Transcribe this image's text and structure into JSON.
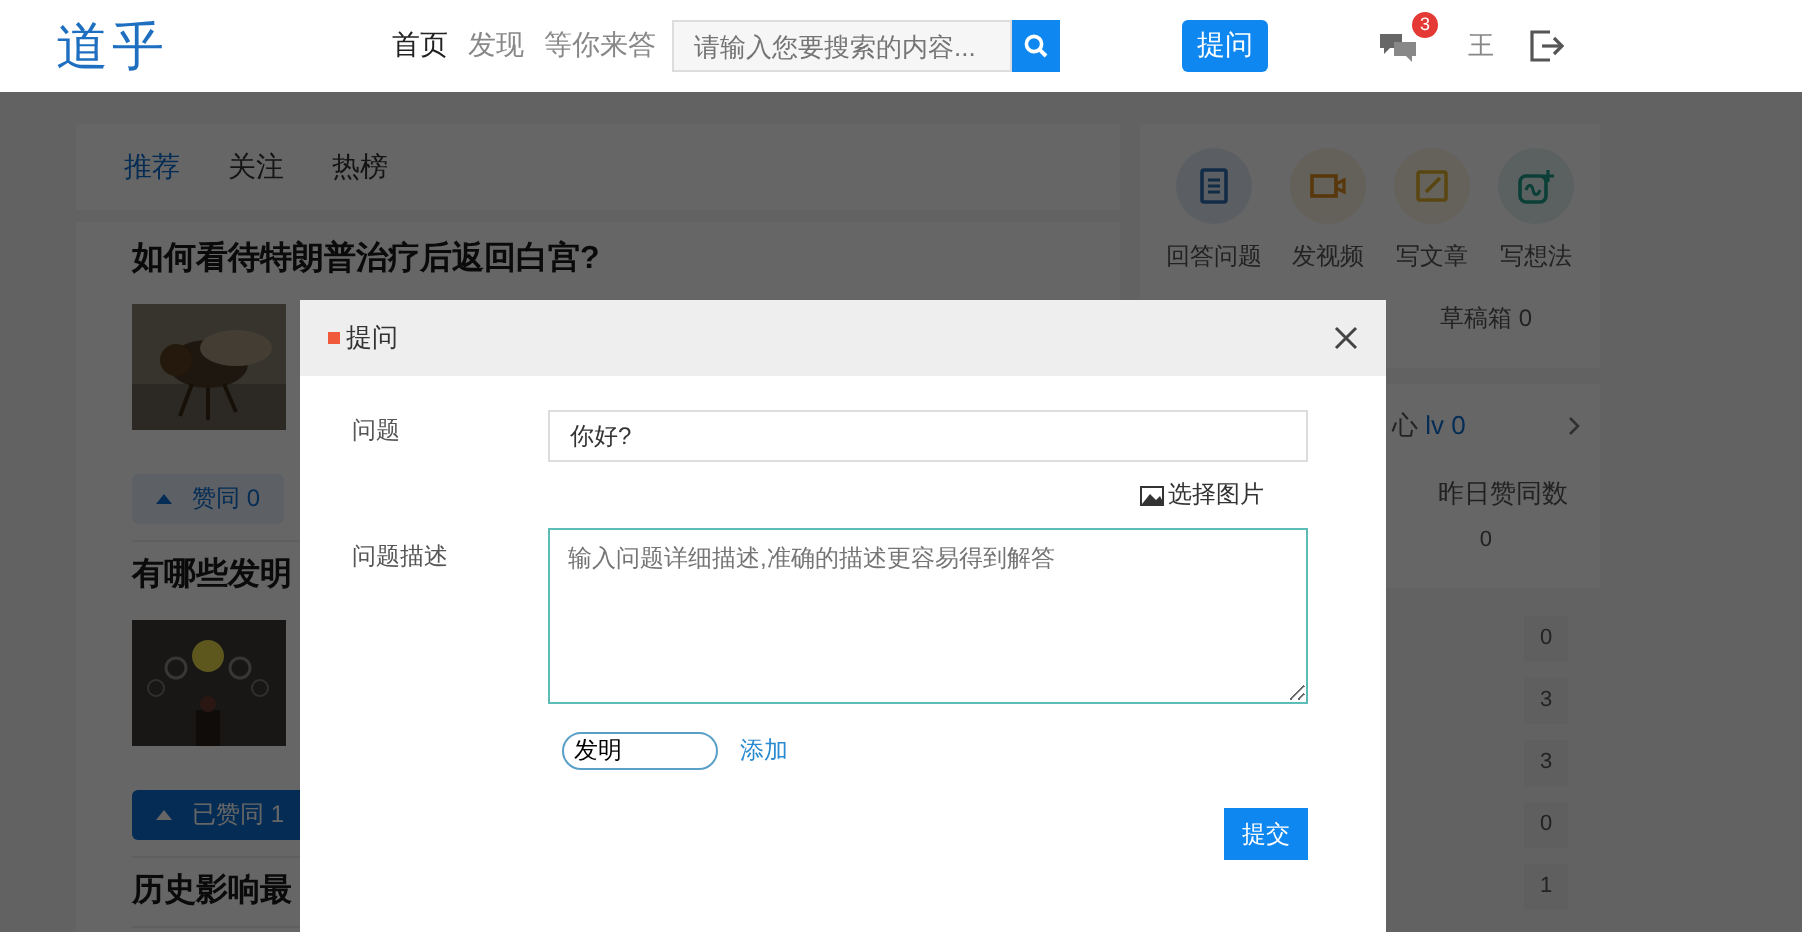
{
  "header": {
    "logo": "道乎",
    "nav": [
      {
        "label": "首页",
        "selected": true
      },
      {
        "label": "发现",
        "selected": false
      },
      {
        "label": "等你来答",
        "selected": false
      }
    ],
    "search": {
      "placeholder": "请输入您要搜索的内容..."
    },
    "ask_button": "提问",
    "message_badge": "3",
    "user": "王"
  },
  "feed": {
    "tabs": [
      {
        "label": "推荐",
        "selected": true
      },
      {
        "label": "关注",
        "selected": false
      },
      {
        "label": "热榜",
        "selected": false
      }
    ],
    "questions": [
      {
        "title": "如何看待特朗普治疗后返回白宫?",
        "vote": {
          "label": "赞同 0",
          "voted": false
        }
      },
      {
        "title": "有哪些发明",
        "vote": {
          "label": "已赞同 1",
          "voted": true
        }
      },
      {
        "title": "历史影响最"
      }
    ]
  },
  "sidebar": {
    "actions": [
      {
        "label": "回答问题",
        "kind": "document"
      },
      {
        "label": "发视频",
        "kind": "video"
      },
      {
        "label": "写文章",
        "kind": "edit"
      },
      {
        "label": "写想法",
        "kind": "idea"
      }
    ],
    "drafts": "草稿箱 0",
    "center": {
      "title": "心",
      "rank": "lv 0",
      "stat_label": "昨日赞同数",
      "stat_value": "0"
    },
    "counts": [
      "0",
      "3",
      "3",
      "0",
      "1"
    ]
  },
  "dialog": {
    "title": "提问",
    "question_label": "问题",
    "question_value": "你好?",
    "image_link": "选择图片",
    "description_label": "问题描述",
    "description_placeholder": "输入问题详细描述,准确的描述更容易得到解答",
    "tag_value": "发明",
    "add_link": "添加",
    "submit": "提交"
  }
}
